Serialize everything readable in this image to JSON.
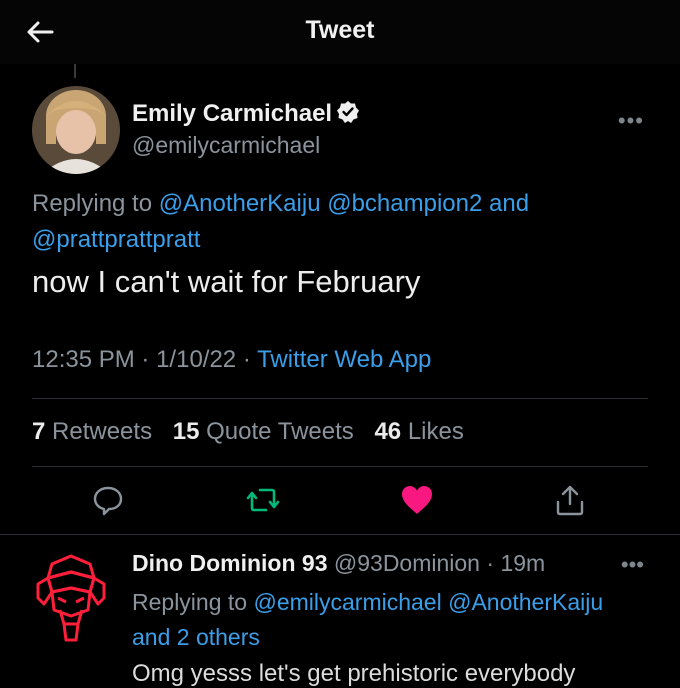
{
  "header": {
    "title": "Tweet"
  },
  "tweet": {
    "author_name": "Emily Carmichael",
    "author_handle": "@emilycarmichael",
    "replying_prefix": "Replying to",
    "replying_mentions": [
      "@AnotherKaiju",
      "@bchampion2"
    ],
    "replying_and": "and",
    "replying_last": "@prattprattpratt",
    "text": "now I can't wait for February",
    "time": "12:35 PM",
    "date": "1/10/22",
    "source": "Twitter Web App",
    "retweets_count": "7",
    "retweets_label": "Retweets",
    "quotes_count": "15",
    "quotes_label": "Quote Tweets",
    "likes_count": "46",
    "likes_label": "Likes",
    "colors": {
      "link": "#3b9ee8",
      "retweet": "#00ba7c",
      "like": "#f91880"
    }
  },
  "reply": {
    "author_name": "Dino Dominion 93",
    "author_handle": "@93Dominion",
    "time": "19m",
    "replying_prefix": "Replying to",
    "replying_mentions": [
      "@emilycarmichael",
      "@AnotherKaiju"
    ],
    "replying_others": "and 2 others",
    "text": "Omg yesss let's get prehistoric everybody"
  }
}
